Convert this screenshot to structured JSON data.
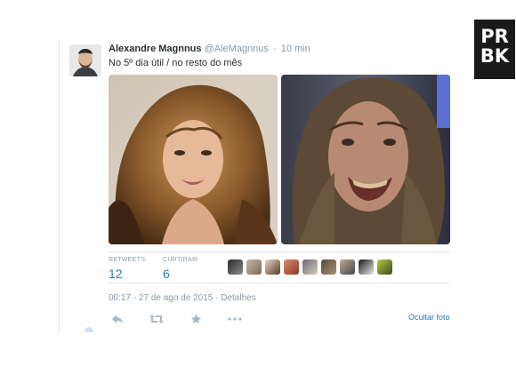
{
  "tweet": {
    "author_name": "Alexandre Magnnus",
    "author_handle": "@AleMagnnus",
    "separator": "·",
    "time_ago": "10 min",
    "text": "No 5º dia útil / no resto do mês",
    "stats": {
      "retweets_label": "RETWEETS",
      "retweets_value": "12",
      "likes_label": "CURTIRAM",
      "likes_value": "6"
    },
    "timestamp": "00:17 - 27 de ago de 2015",
    "details_link": "Detalhes",
    "hide_photo_link": "Ocultar foto",
    "liker_count_shown": 9
  },
  "watermark": {
    "logo_line1": "PR",
    "logo_line2": "BK"
  },
  "icons": [
    "reply-icon",
    "retweet-icon",
    "favorite-icon",
    "more-icon"
  ],
  "colors": {
    "link": "#2b7bb9",
    "muted": "#8899a6",
    "text": "#292f33",
    "divider": "#e1e8ed"
  }
}
